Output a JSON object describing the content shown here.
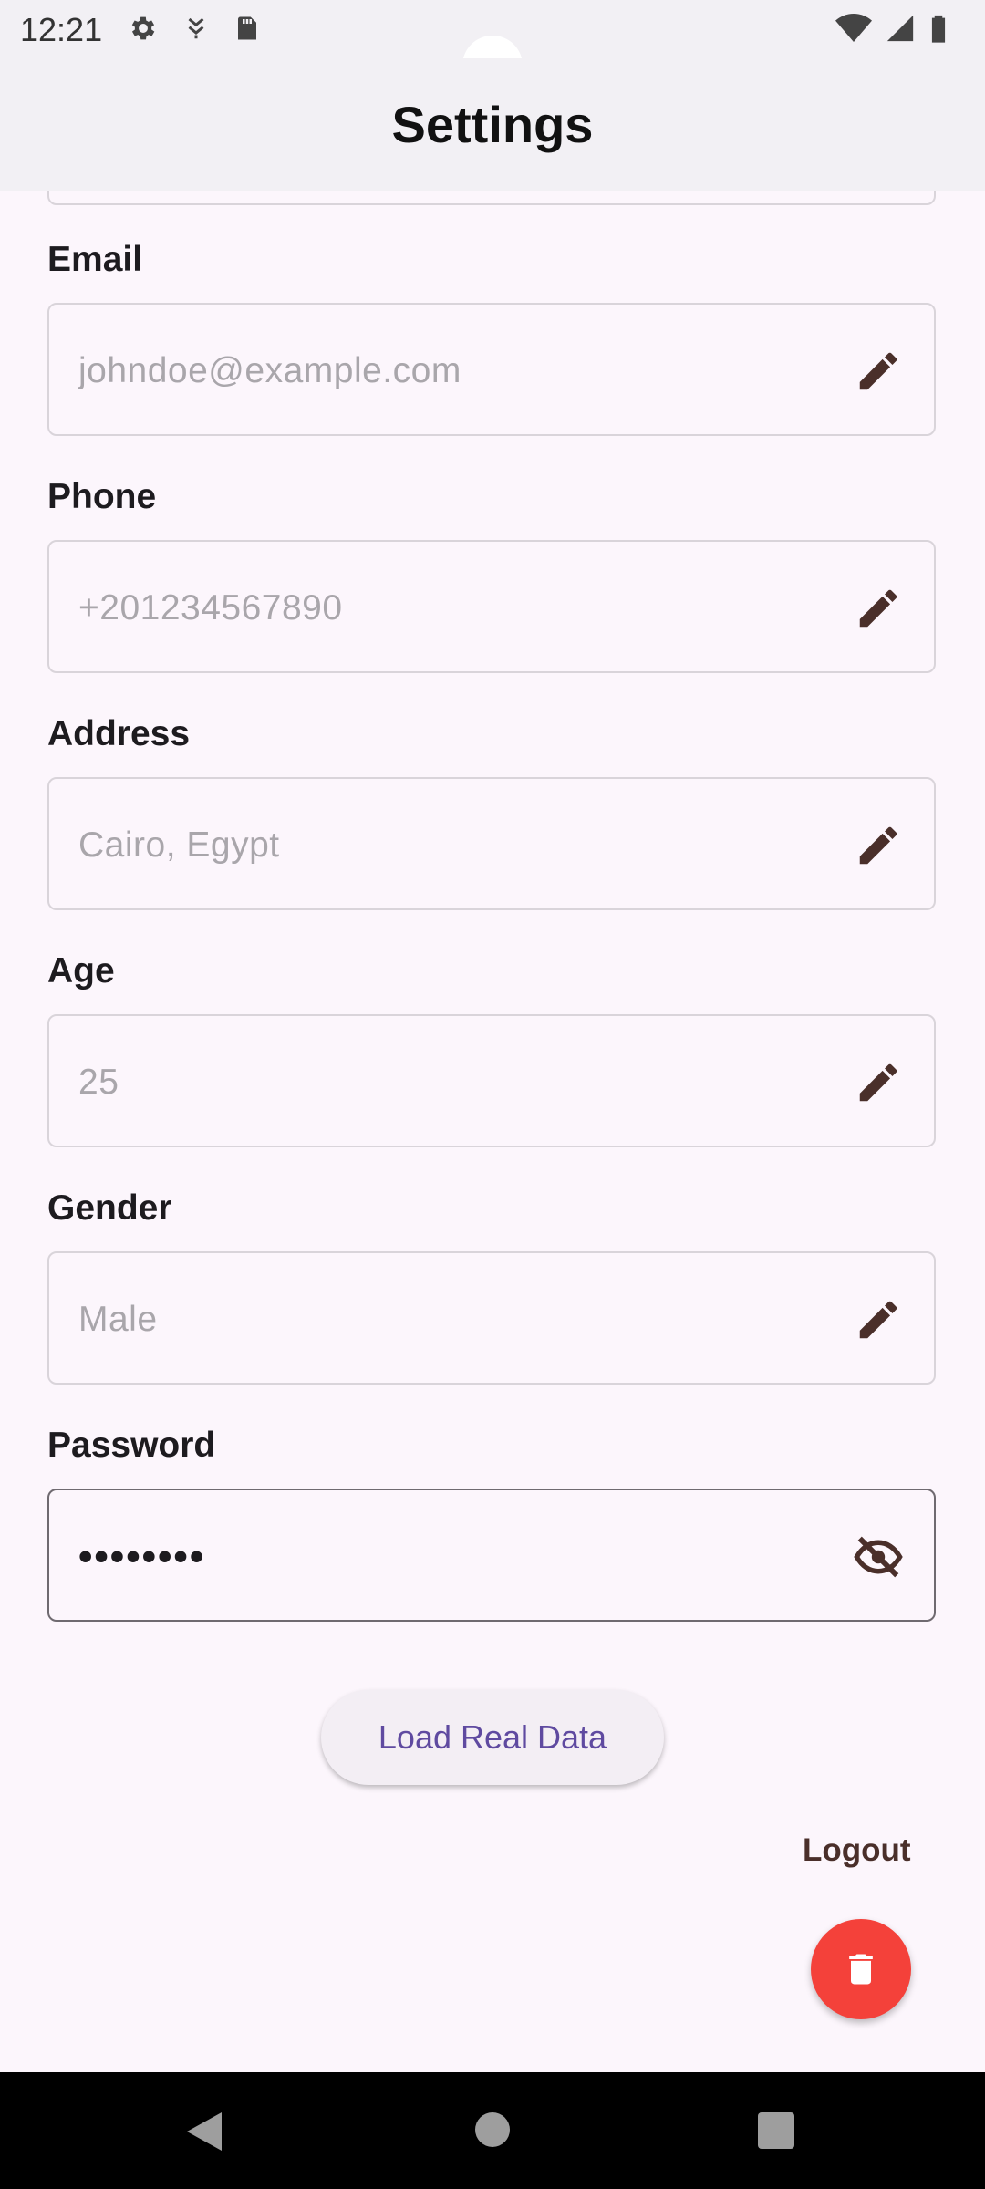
{
  "status_bar": {
    "time": "12:21",
    "left_icons": [
      "settings-gear-icon",
      "download-icon",
      "sd-card-icon"
    ],
    "right_icons": [
      "wifi-icon",
      "signal-icon",
      "battery-icon"
    ]
  },
  "app_bar": {
    "title": "Settings"
  },
  "fields": [
    {
      "label": "Email",
      "value": "johndoe@example.com",
      "icon": "edit-pencil-icon"
    },
    {
      "label": "Phone",
      "value": "+201234567890",
      "icon": "edit-pencil-icon"
    },
    {
      "label": "Address",
      "value": "Cairo, Egypt",
      "icon": "edit-pencil-icon"
    },
    {
      "label": "Age",
      "value": "25",
      "icon": "edit-pencil-icon"
    },
    {
      "label": "Gender",
      "value": "Male",
      "icon": "edit-pencil-icon"
    },
    {
      "label": "Password",
      "value": "••••••••",
      "icon": "visibility-off-icon"
    }
  ],
  "actions": {
    "load_label": "Load Real Data",
    "logout_label": "Logout",
    "delete_icon": "trash-icon"
  },
  "colors": {
    "background": "#fcf6fc",
    "app_bar": "#f2f0f4",
    "accent_text": "#5f4aa0",
    "fab": "#f4413a",
    "icon": "#4a2f2a"
  },
  "nav": [
    "back-icon",
    "home-icon",
    "recents-icon"
  ]
}
